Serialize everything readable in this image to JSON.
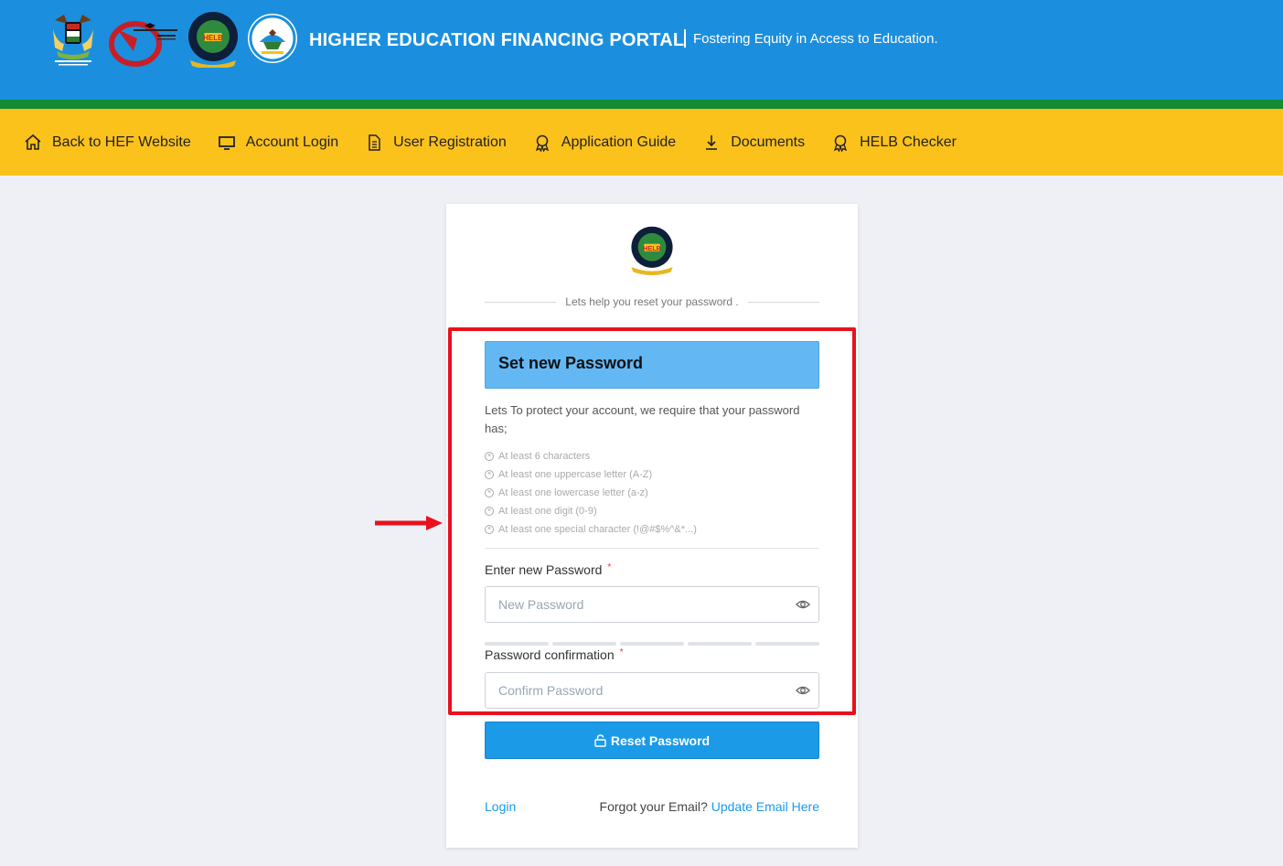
{
  "header": {
    "title": "HIGHER EDUCATION FINANCING PORTAL",
    "tagline": "Fostering Equity in Access to Education.",
    "colors": {
      "blue": "#1b8fde",
      "green": "#138a34",
      "yellow": "#fcc21c"
    }
  },
  "nav": [
    {
      "label": "Back to HEF Website",
      "icon": "home-icon"
    },
    {
      "label": "Account Login",
      "icon": "monitor-icon"
    },
    {
      "label": "User Registration",
      "icon": "document-icon"
    },
    {
      "label": "Application Guide",
      "icon": "award-icon"
    },
    {
      "label": "Documents",
      "icon": "download-icon"
    },
    {
      "label": "HELB Checker",
      "icon": "award-icon"
    }
  ],
  "card": {
    "logo_text": "HELB",
    "subtitle": "Lets help you reset your password .",
    "section_title": "Set new Password",
    "description": "Lets To protect your account, we require that your password has;",
    "requirements": [
      "At least 6 characters",
      "At least one uppercase letter (A-Z)",
      "At least one lowercase letter (a-z)",
      "At least one digit (0-9)",
      "At least one special character (!@#$%^&*...)"
    ],
    "new_password_label": "Enter new Password",
    "new_password_placeholder": "New Password",
    "confirm_label": "Password confirmation",
    "confirm_placeholder": "Confirm Password",
    "required_mark": "*",
    "reset_button": "Reset Password",
    "login_link": "Login",
    "forgot_text": "Forgot your Email?",
    "update_email_link": "Update Email Here"
  }
}
